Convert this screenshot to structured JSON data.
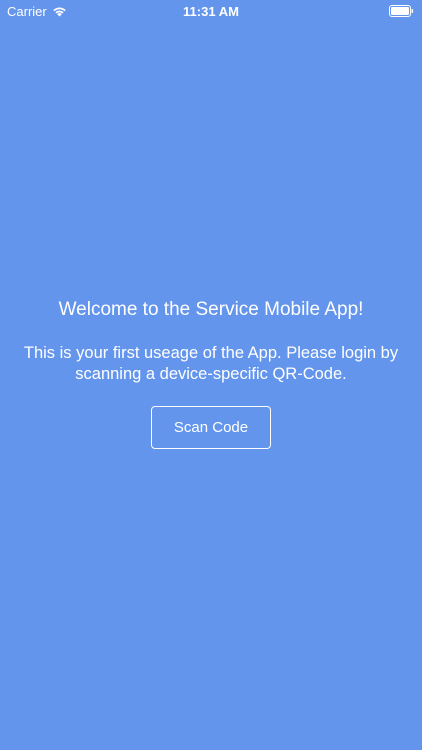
{
  "status_bar": {
    "carrier": "Carrier",
    "time": "11:31 AM",
    "wifi_icon": "wifi-icon",
    "battery_icon": "battery-icon"
  },
  "main": {
    "title": "Welcome to the Service Mobile App!",
    "description": "This is your first useage of the App. Please login by scanning a device-specific QR-Code.",
    "scan_button_label": "Scan Code"
  },
  "colors": {
    "background": "#6495ED",
    "text": "#FFFFFF"
  }
}
